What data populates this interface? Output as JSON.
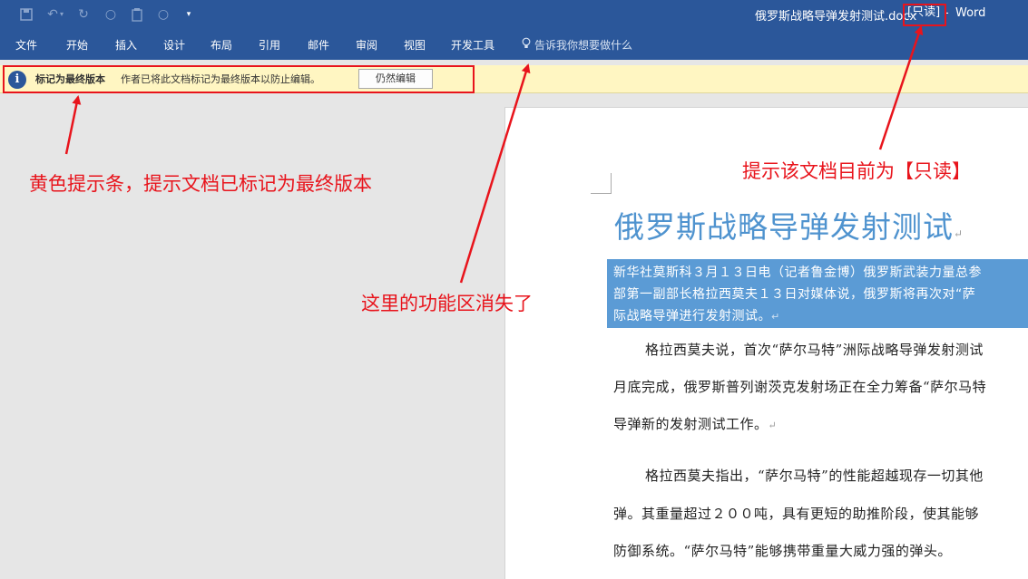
{
  "titlebar": {
    "document_name": "俄罗斯战略导弹发射测试.docx",
    "readonly_tag": "[只读]",
    "separator": "-",
    "app_name": "Word",
    "qat_icons": [
      "save-icon",
      "undo-icon",
      "redo-icon",
      "circle-icon",
      "paste-icon",
      "circle-icon",
      "customize-qat-icon"
    ]
  },
  "menu": {
    "tabs": [
      "文件",
      "开始",
      "插入",
      "设计",
      "布局",
      "引用",
      "邮件",
      "审阅",
      "视图",
      "开发工具"
    ],
    "tellme": "告诉我你想要做什么"
  },
  "message_bar": {
    "title": "标记为最终版本",
    "text": "作者已将此文档标记为最终版本以防止编辑。",
    "button": "仍然编辑"
  },
  "document": {
    "title": "俄罗斯战略导弹发射测试",
    "highlighted_lines": [
      "新华社莫斯科３月１３日电（记者鲁金博）俄罗斯武装力量总参",
      "部第一副部长格拉西莫夫１３日对媒体说，俄罗斯将再次对“萨",
      "际战略导弹进行发射测试。"
    ],
    "body_lines": [
      "格拉西莫夫说，首次“萨尔马特”洲际战略导弹发射测试",
      "月底完成，俄罗斯普列谢茨克发射场正在全力筹备“萨尔马特",
      "导弹新的发射测试工作。",
      "格拉西莫夫指出，“萨尔马特”的性能超越现存一切其他",
      "弹。其重量超过２００吨，具有更短的助推阶段，使其能够",
      "防御系统。“萨尔马特”能够携带重量大威力强的弹头。"
    ]
  },
  "annotations": {
    "readonly_note": "提示该文档目前为【只读】",
    "message_bar_note": "黄色提示条，提示文档已标记为最终版本",
    "ribbon_note": "这里的功能区消失了",
    "color": "#e8141c"
  }
}
